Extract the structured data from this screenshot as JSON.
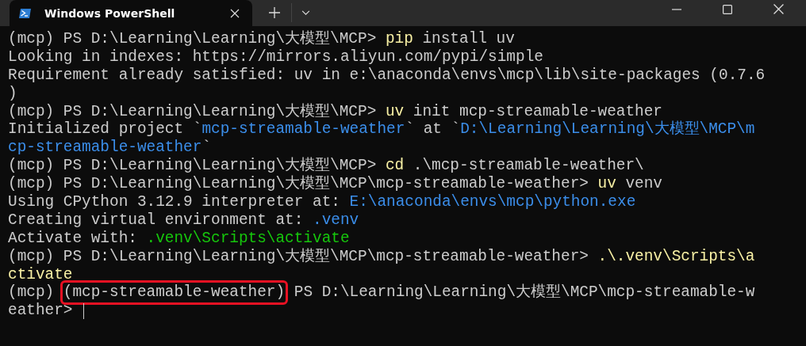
{
  "window": {
    "tab_title": "Windows PowerShell"
  },
  "lines": [
    [
      {
        "kind": "text",
        "text": "(mcp) PS D:\\Learning\\Learning\\大模型\\MCP> "
      },
      {
        "kind": "command",
        "text": "pip"
      },
      {
        "kind": "text",
        "text": " install uv"
      }
    ],
    [
      {
        "kind": "text",
        "text": "Looking in indexes: https://mirrors.aliyun.com/pypi/simple"
      }
    ],
    [
      {
        "kind": "text",
        "text": "Requirement already satisfied: uv in e:\\anaconda\\envs\\mcp\\lib\\site-packages (0.7.6"
      }
    ],
    [
      {
        "kind": "text",
        "text": ")"
      }
    ],
    [
      {
        "kind": "text",
        "text": "(mcp) PS D:\\Learning\\Learning\\大模型\\MCP> "
      },
      {
        "kind": "command",
        "text": "uv"
      },
      {
        "kind": "text",
        "text": " init mcp-streamable-weather"
      }
    ],
    [
      {
        "kind": "text",
        "text": "Initialized project `"
      },
      {
        "kind": "link",
        "text": "mcp-streamable-weather"
      },
      {
        "kind": "text",
        "text": "` at `"
      },
      {
        "kind": "link",
        "text": "D:\\Learning\\Learning\\大模型\\MCP\\m"
      }
    ],
    [
      {
        "kind": "link",
        "text": "cp-streamable-weather"
      },
      {
        "kind": "text",
        "text": "`"
      }
    ],
    [
      {
        "kind": "text",
        "text": "(mcp) PS D:\\Learning\\Learning\\大模型\\MCP> "
      },
      {
        "kind": "command",
        "text": "cd"
      },
      {
        "kind": "text",
        "text": " .\\mcp-streamable-weather\\"
      }
    ],
    [
      {
        "kind": "text",
        "text": "(mcp) PS D:\\Learning\\Learning\\大模型\\MCP\\mcp-streamable-weather> "
      },
      {
        "kind": "command",
        "text": "uv"
      },
      {
        "kind": "text",
        "text": " venv"
      }
    ],
    [
      {
        "kind": "text",
        "text": "Using CPython 3.12.9 interpreter at: "
      },
      {
        "kind": "link",
        "text": "E:\\anaconda\\envs\\mcp\\python.exe"
      }
    ],
    [
      {
        "kind": "text",
        "text": "Creating virtual environment at: "
      },
      {
        "kind": "link",
        "text": ".venv"
      }
    ],
    [
      {
        "kind": "text",
        "text": "Activate with: "
      },
      {
        "kind": "success",
        "text": ".venv\\Scripts\\activate"
      }
    ],
    [
      {
        "kind": "text",
        "text": "(mcp) PS D:\\Learning\\Learning\\大模型\\MCP\\mcp-streamable-weather> "
      },
      {
        "kind": "command",
        "text": ".\\.venv\\Scripts\\a"
      }
    ],
    [
      {
        "kind": "command",
        "text": "ctivate"
      }
    ],
    [
      {
        "kind": "text",
        "text": "(mcp) "
      },
      {
        "kind": "boxed",
        "text": "(mcp-streamable-weather)"
      },
      {
        "kind": "text",
        "text": " PS D:\\Learning\\Learning\\大模型\\MCP\\mcp-streamable-w"
      }
    ],
    [
      {
        "kind": "text",
        "text": "eather> "
      }
    ]
  ]
}
